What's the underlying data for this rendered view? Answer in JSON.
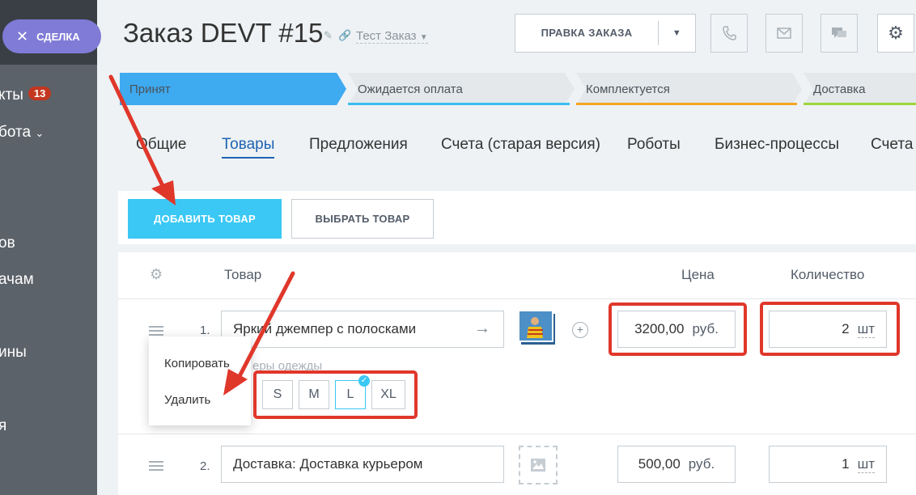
{
  "sidebar": {
    "deal_button": "СДЕЛКА",
    "items": [
      {
        "label": "кты",
        "badge": "13"
      },
      {
        "label": "бота"
      },
      {
        "label": "ов"
      },
      {
        "label": "ачам"
      },
      {
        "label": "ины"
      },
      {
        "label": "я"
      }
    ]
  },
  "header": {
    "title": "Заказ DEVT  #15",
    "subtitle": "Тест Заказ",
    "edit_button": "ПРАВКА ЗАКАЗА"
  },
  "stages": [
    {
      "label": "Принят",
      "color": "#3eaaf0"
    },
    {
      "label": "Ожидается оплата",
      "color": "#39bdf0"
    },
    {
      "label": "Комплектуется",
      "color": "#f5a623"
    },
    {
      "label": "Доставка",
      "color": "#9fd53b"
    }
  ],
  "tabs": [
    {
      "label": "Общие"
    },
    {
      "label": "Товары"
    },
    {
      "label": "Предложения"
    },
    {
      "label": "Счета (старая версия)"
    },
    {
      "label": "Роботы"
    },
    {
      "label": "Бизнес-процессы"
    },
    {
      "label": "Счета"
    }
  ],
  "toolbar": {
    "add_button": "ДОБАВИТЬ ТОВАР",
    "pick_button": "ВЫБРАТЬ ТОВАР"
  },
  "table": {
    "headers": {
      "product": "Товар",
      "price": "Цена",
      "quantity": "Количество"
    },
    "rows": [
      {
        "num": "1.",
        "name": "Яркий джемпер с полосками",
        "price": "3200,00",
        "currency": "руб.",
        "qty": "2",
        "unit": "шт",
        "sizes_label": "еры одежды",
        "sizes": [
          "S",
          "M",
          "L",
          "XL"
        ],
        "selected_size": "L"
      },
      {
        "num": "2.",
        "name": "Доставка: Доставка курьером",
        "price": "500,00",
        "currency": "руб.",
        "qty": "1",
        "unit": "шт"
      }
    ]
  },
  "context_menu": {
    "items": [
      "Копировать",
      "Удалить"
    ]
  }
}
